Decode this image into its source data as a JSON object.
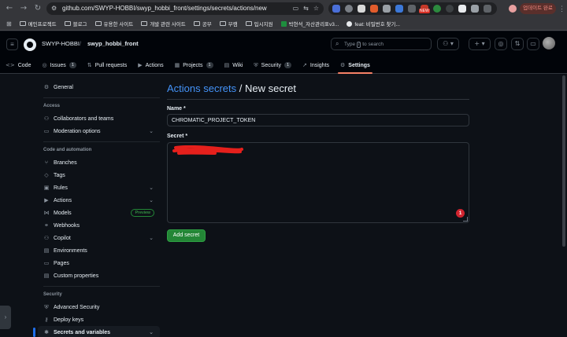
{
  "browser": {
    "url": "github.com/SWYP-HOBBI/swyp_hobbi_front/settings/secrets/actions/new",
    "new_badge": "NEW",
    "update_button": "업데이트 완료",
    "bookmarks": [
      {
        "label": "메인프로젝트",
        "kind": "folder"
      },
      {
        "label": "블로그",
        "kind": "folder"
      },
      {
        "label": "유용한 사이트",
        "kind": "folder"
      },
      {
        "label": "개발 관련 사이트",
        "kind": "folder"
      },
      {
        "label": "공부",
        "kind": "folder"
      },
      {
        "label": "부캠",
        "kind": "folder"
      },
      {
        "label": "입시지원",
        "kind": "folder"
      },
      {
        "label": "박현석_자산관리표v3...",
        "kind": "sheet"
      },
      {
        "label": "feat: 비밀번호 찾기...",
        "kind": "github"
      }
    ]
  },
  "header": {
    "owner": "SWYP-HOBBI",
    "separator": "/",
    "repo": "swyp_hobbi_front",
    "search": {
      "type_word": "Type",
      "key": "/",
      "rest": "to search"
    },
    "add_symbol": "+"
  },
  "repo_nav": [
    {
      "label": "Code",
      "icon": "<>",
      "count": ""
    },
    {
      "label": "Issues",
      "icon": "◎",
      "count": "1"
    },
    {
      "label": "Pull requests",
      "icon": "⇅",
      "count": ""
    },
    {
      "label": "Actions",
      "icon": "▶",
      "count": ""
    },
    {
      "label": "Projects",
      "icon": "▦",
      "count": "1"
    },
    {
      "label": "Wiki",
      "icon": "▤",
      "count": ""
    },
    {
      "label": "Security",
      "icon": "⛨",
      "count": "1"
    },
    {
      "label": "Insights",
      "icon": "↗",
      "count": ""
    },
    {
      "label": "Settings",
      "icon": "⚙",
      "count": ""
    }
  ],
  "sidebar": {
    "general": "General",
    "access_heading": "Access",
    "access": [
      {
        "label": "Collaborators and teams"
      },
      {
        "label": "Moderation options"
      }
    ],
    "code_heading": "Code and automation",
    "code": [
      {
        "label": "Branches"
      },
      {
        "label": "Tags"
      },
      {
        "label": "Rules"
      },
      {
        "label": "Actions"
      },
      {
        "label": "Models",
        "badge": "Preview"
      },
      {
        "label": "Webhooks"
      },
      {
        "label": "Copilot"
      },
      {
        "label": "Environments"
      },
      {
        "label": "Pages"
      },
      {
        "label": "Custom properties"
      }
    ],
    "security_heading": "Security",
    "security": [
      {
        "label": "Advanced Security"
      },
      {
        "label": "Deploy keys"
      },
      {
        "label": "Secrets and variables"
      }
    ]
  },
  "main": {
    "title_link": "Actions secrets",
    "title_rest": " / New secret",
    "name_label": "Name *",
    "name_value": "CHROMATIC_PROJECT_TOKEN",
    "secret_label": "Secret *",
    "error_count": "1",
    "submit_label": "Add secret"
  },
  "colors": {
    "accent_link": "#4493f8",
    "primary_button": "#238636",
    "active_tab_underline": "#f78166",
    "redaction": "#e5201c",
    "error_badge": "#d1242f"
  }
}
